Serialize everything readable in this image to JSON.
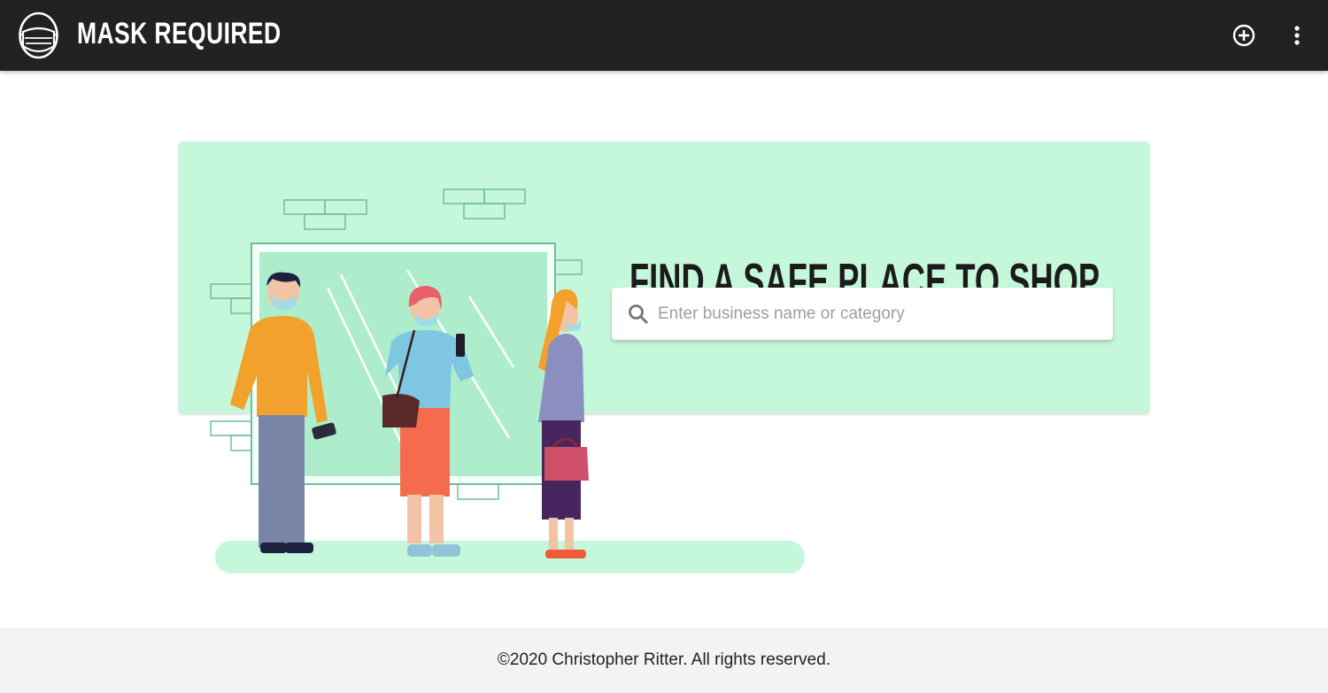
{
  "header": {
    "brand": "MASK REQUIRED",
    "logo_icon": "mask-face-icon",
    "add_icon": "plus-circle-icon",
    "menu_icon": "more-vertical-icon",
    "background": "#222222"
  },
  "hero": {
    "headline": "FIND A SAFE PLACE TO SHOP.",
    "background": "#c5f7da",
    "search": {
      "placeholder": "Enter business name or category",
      "value": "",
      "icon": "search-icon"
    }
  },
  "footer": {
    "copyright": "©2020 Christopher Ritter. All rights reserved."
  }
}
